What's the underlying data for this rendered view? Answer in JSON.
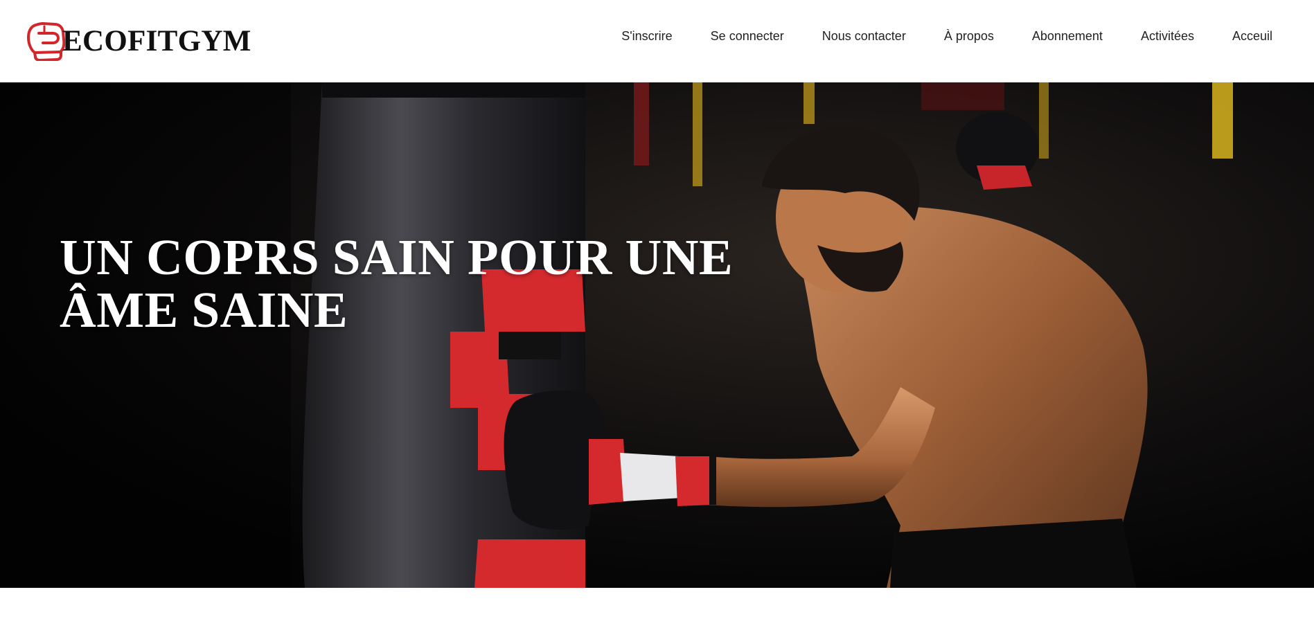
{
  "brand": {
    "name": "ECOFITGYM",
    "logo_icon": "boxing-glove-icon",
    "logo_color": "#d3262b"
  },
  "nav": {
    "items": [
      {
        "label": "S'inscrire"
      },
      {
        "label": "Se connecter"
      },
      {
        "label": "Nous contacter"
      },
      {
        "label": "À propos"
      },
      {
        "label": "Abonnement"
      },
      {
        "label": "Activitées"
      },
      {
        "label": "Acceuil"
      }
    ]
  },
  "hero": {
    "title": "UN COPRS SAIN POUR UNE ÂME SAINE",
    "image_subject": "boxer-punching-bag-photo"
  },
  "colors": {
    "accent_red": "#d3262b",
    "nav_text": "#222222",
    "hero_text": "#ffffff"
  }
}
